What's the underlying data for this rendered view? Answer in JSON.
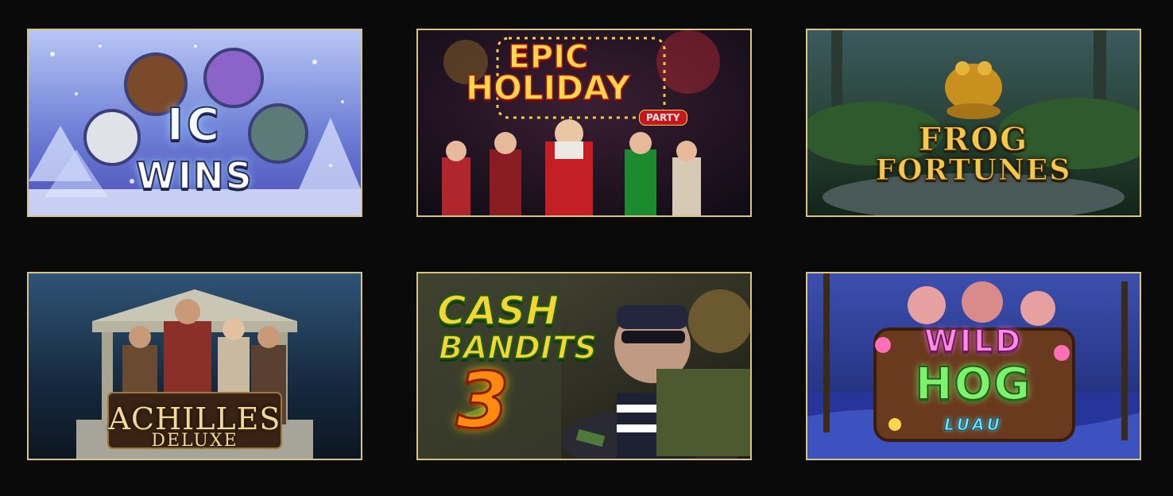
{
  "page": {
    "background_color": "#0a0a0a",
    "tile_border_color": "#d8c483"
  },
  "games": [
    {
      "id": "ic-wins",
      "title_lines": [
        "IC",
        "WINS"
      ],
      "icon": "ic-wins-artwork",
      "accent_color": "#7b9be0"
    },
    {
      "id": "epic-holiday-party",
      "title_lines": [
        "EPIC",
        "HOLIDAY",
        "PARTY"
      ],
      "icon": "epic-holiday-party-artwork",
      "accent_color": "#c8161d"
    },
    {
      "id": "frog-fortunes",
      "title_lines": [
        "FROG",
        "FORTUNES"
      ],
      "icon": "frog-fortunes-artwork",
      "accent_color": "#f3c84b"
    },
    {
      "id": "achilles-deluxe",
      "title_lines": [
        "ACHILLES",
        "DELUXE"
      ],
      "icon": "achilles-deluxe-artwork",
      "accent_color": "#2b4a6a"
    },
    {
      "id": "cash-bandits-3",
      "title_lines": [
        "CASH",
        "BANDITS",
        "3"
      ],
      "icon": "cash-bandits-3-artwork",
      "accent_color": "#f5d631"
    },
    {
      "id": "wild-hog-luau",
      "title_lines": [
        "WILD",
        "HOG",
        "LUAU"
      ],
      "icon": "wild-hog-luau-artwork",
      "accent_color": "#7df26c"
    }
  ]
}
